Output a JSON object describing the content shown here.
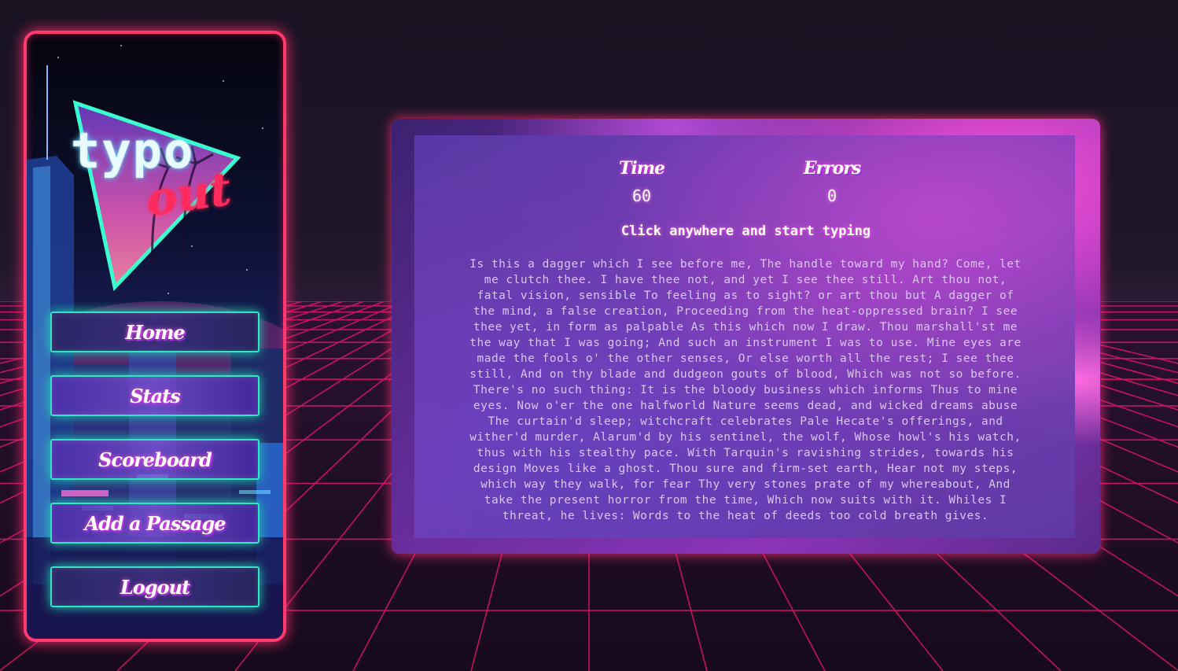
{
  "app": {
    "logo_text_top": "typo",
    "logo_text_bottom": "out"
  },
  "sidebar": {
    "items": [
      {
        "label": "Home"
      },
      {
        "label": "Stats"
      },
      {
        "label": "Scoreboard"
      },
      {
        "label": "Add a Passage"
      },
      {
        "label": "Logout"
      }
    ]
  },
  "game": {
    "time_label": "Time",
    "time_value": "60",
    "errors_label": "Errors",
    "errors_value": "0",
    "prompt": "Click anywhere and start typing",
    "passage": "Is this a dagger which I see before me, The handle toward my hand? Come, let me clutch thee. I have thee not, and yet I see thee still. Art thou not, fatal vision, sensible To feeling as to sight? or art thou but A dagger of the mind, a false creation, Proceeding from the heat-oppressed brain? I see thee yet, in form as palpable As this which now I draw. Thou marshall'st me the way that I was going; And such an instrument I was to use. Mine eyes are made the fools o' the other senses, Or else worth all the rest; I see thee still, And on thy blade and dudgeon gouts of blood, Which was not so before. There's no such thing: It is the bloody business which informs Thus to mine eyes. Now o'er the one halfworld Nature seems dead, and wicked dreams abuse The curtain'd sleep; witchcraft celebrates Pale Hecate's offerings, and wither'd murder, Alarum'd by his sentinel, the wolf, Whose howl's his watch, thus with his stealthy pace. With Tarquin's ravishing strides, towards his design Moves like a ghost. Thou sure and firm-set earth, Hear not my steps, which way they walk, for fear Thy very stones prate of my whereabout, And take the present horror from the time, Which now suits with it. Whiles I threat, he lives: Words to the heat of deeds too cold breath gives."
  },
  "colors": {
    "neon_pink": "#ff3a6e",
    "neon_teal": "#2fe6c6",
    "grid_magenta": "#e0146e",
    "background": "#1d1526"
  }
}
